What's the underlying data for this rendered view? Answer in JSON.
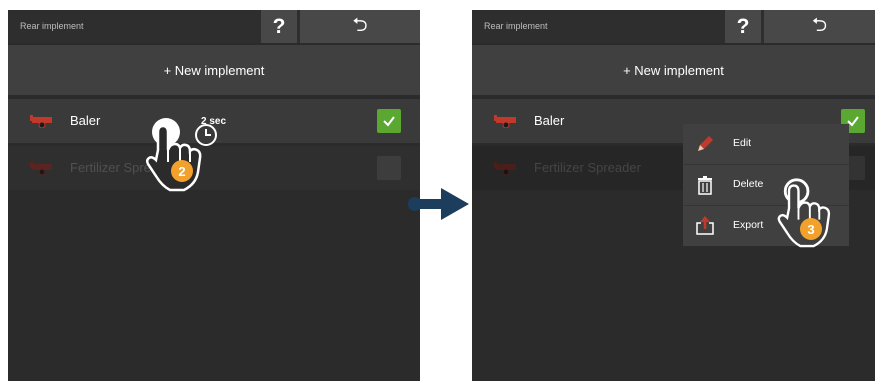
{
  "left_screen": {
    "header": {
      "title": "Rear implement",
      "help_label": "?",
      "back_label": "⮌"
    },
    "new_implement_label": "+ New implement",
    "implements": [
      {
        "label": "Baler",
        "selected": true
      },
      {
        "label": "Fertilizer Spreader",
        "selected": false
      }
    ],
    "gesture": {
      "step": "2",
      "hold_label": "2 sec",
      "icons": [
        "hand-tap-icon",
        "clock-icon"
      ]
    }
  },
  "right_screen": {
    "header": {
      "title": "Rear implement",
      "help_label": "?",
      "back_label": "⮌"
    },
    "new_implement_label": "+ New implement",
    "implements": [
      {
        "label": "Baler",
        "selected": true
      },
      {
        "label": "Fertilizer Spreader",
        "selected": false
      }
    ],
    "context_menu": {
      "items": [
        {
          "label": "Edit",
          "icon": "pencil-icon"
        },
        {
          "label": "Delete",
          "icon": "trash-icon"
        },
        {
          "label": "Export",
          "icon": "export-icon"
        }
      ]
    },
    "gesture": {
      "step": "3",
      "icons": [
        "hand-tap-icon"
      ]
    }
  },
  "colors": {
    "background": "#2b2b2b",
    "header_button": "#484848",
    "accent_check": "#5aa832",
    "implement_red": "#c0392b",
    "step_badge": "#f2a22c",
    "arrow": "#1d3d5c"
  }
}
